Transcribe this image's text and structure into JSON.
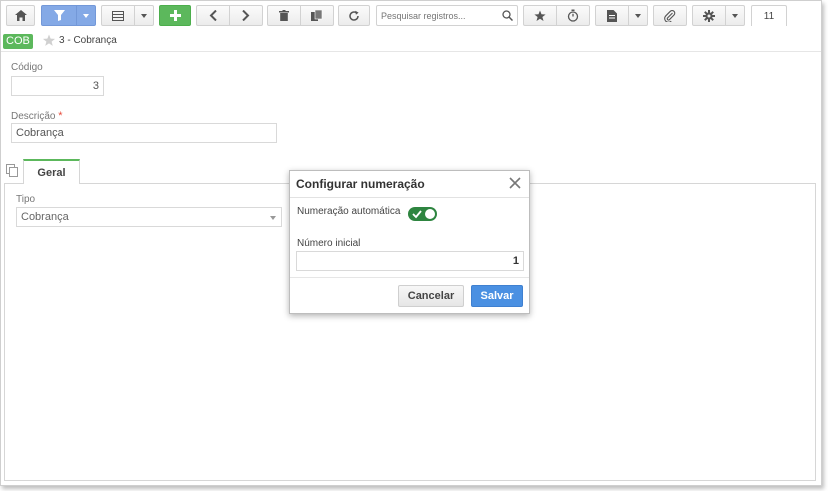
{
  "toolbar": {
    "search_placeholder": "Pesquisar registros...",
    "record_count": "11"
  },
  "breadcrumb": {
    "badge": "COB",
    "title": "3 - Cobrança"
  },
  "form": {
    "codigo_label": "Código",
    "codigo_value": "3",
    "descricao_label": "Descrição",
    "descricao_required": "*",
    "descricao_value": "Cobrança",
    "tab_label": "Geral",
    "tipo_label": "Tipo",
    "tipo_value": "Cobrança"
  },
  "modal": {
    "title": "Configurar numeração",
    "auto_label": "Numeração automática",
    "auto_enabled": true,
    "start_label": "Número inicial",
    "start_value": "1",
    "cancel_label": "Cancelar",
    "save_label": "Salvar"
  },
  "colors": {
    "primary": "#4a90e2",
    "success": "#5cb85c",
    "toggle_on": "#2e8540",
    "required": "#e74c3c"
  }
}
